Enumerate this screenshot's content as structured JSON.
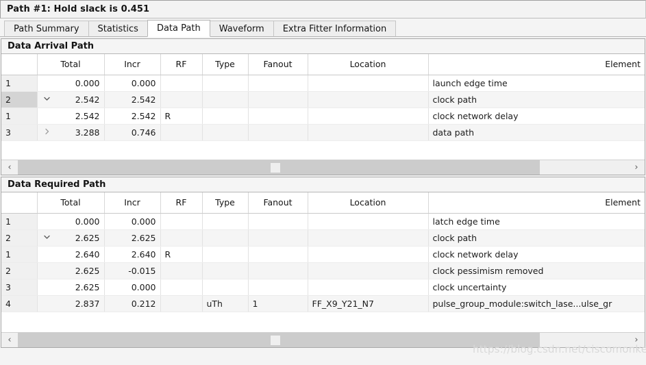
{
  "window": {
    "title": "Path #1: Hold slack is 0.451"
  },
  "tabs": [
    {
      "label": "Path Summary",
      "active": false
    },
    {
      "label": "Statistics",
      "active": false
    },
    {
      "label": "Data Path",
      "active": true
    },
    {
      "label": "Waveform",
      "active": false
    },
    {
      "label": "Extra Fitter Information",
      "active": false
    }
  ],
  "columns": [
    "",
    "Total",
    "Incr",
    "RF",
    "Type",
    "Fanout",
    "Location",
    "Element"
  ],
  "arrival": {
    "title": "Data Arrival Path",
    "rows": [
      {
        "idx": "1",
        "twisty": "none",
        "indent": 0,
        "selected": false,
        "total": "0.000",
        "incr": "0.000",
        "rf": "",
        "type": "",
        "fanout": "",
        "location": "",
        "element": "launch edge time"
      },
      {
        "idx": "2",
        "twisty": "expanded",
        "indent": 0,
        "selected": true,
        "total": "2.542",
        "incr": "2.542",
        "rf": "",
        "type": "",
        "fanout": "",
        "location": "",
        "element": "clock path"
      },
      {
        "idx": "1",
        "twisty": "none",
        "indent": 1,
        "selected": false,
        "total": "2.542",
        "incr": "2.542",
        "rf": "R",
        "type": "",
        "fanout": "",
        "location": "",
        "element": "clock network delay"
      },
      {
        "idx": "3",
        "twisty": "collapsed",
        "indent": 0,
        "selected": false,
        "total": "3.288",
        "incr": "0.746",
        "rf": "",
        "type": "",
        "fanout": "",
        "location": "",
        "element": "data path"
      }
    ],
    "scrollbar": {
      "left_arrow": "‹",
      "right_arrow": "›"
    }
  },
  "required": {
    "title": "Data Required Path",
    "rows": [
      {
        "idx": "1",
        "twisty": "none",
        "indent": 0,
        "selected": false,
        "total": "0.000",
        "incr": "0.000",
        "rf": "",
        "type": "",
        "fanout": "",
        "location": "",
        "element": "latch edge time"
      },
      {
        "idx": "2",
        "twisty": "expanded",
        "indent": 0,
        "selected": false,
        "total": "2.625",
        "incr": "2.625",
        "rf": "",
        "type": "",
        "fanout": "",
        "location": "",
        "element": "clock path"
      },
      {
        "idx": "1",
        "twisty": "none",
        "indent": 1,
        "selected": false,
        "total": "2.640",
        "incr": "2.640",
        "rf": "R",
        "type": "",
        "fanout": "",
        "location": "",
        "element": "clock network delay"
      },
      {
        "idx": "2",
        "twisty": "none",
        "indent": 1,
        "selected": false,
        "total": "2.625",
        "incr": "-0.015",
        "rf": "",
        "type": "",
        "fanout": "",
        "location": "",
        "element": "clock pessimism removed"
      },
      {
        "idx": "3",
        "twisty": "none",
        "indent": 0,
        "selected": false,
        "total": "2.625",
        "incr": "0.000",
        "rf": "",
        "type": "",
        "fanout": "",
        "location": "",
        "element": "clock uncertainty"
      },
      {
        "idx": "4",
        "twisty": "none",
        "indent": 0,
        "selected": false,
        "total": "2.837",
        "incr": "0.212",
        "rf": "",
        "type": "uTh",
        "fanout": "1",
        "location": "FF_X9_Y21_N7",
        "element": "pulse_group_module:switch_lase...ulse_gr"
      }
    ],
    "scrollbar": {
      "left_arrow": "‹",
      "right_arrow": "›"
    }
  },
  "watermark": {
    "text": "https://blog.csdn.net/ciscomonkey"
  },
  "colors": {
    "selected_row_header": "#d4d4d4",
    "row_header": "#f0f0f0",
    "stripe": "#f5f5f5",
    "scroll_thumb": "#cccccc",
    "watermark": "#d9d9d9"
  }
}
